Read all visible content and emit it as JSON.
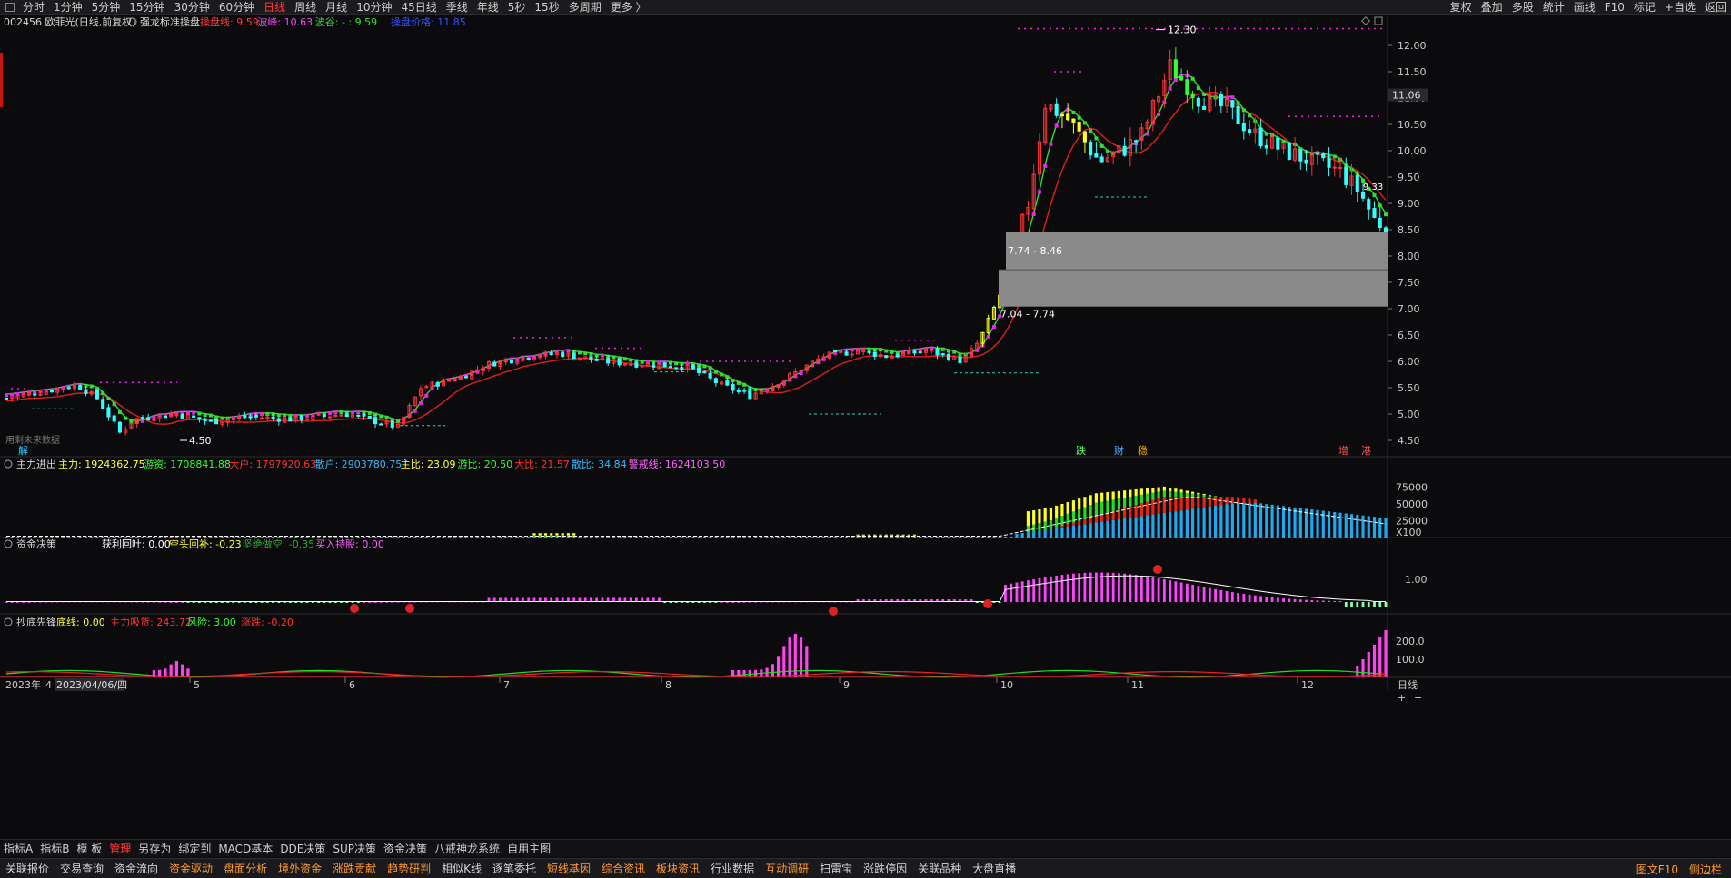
{
  "topbar": {
    "periods": [
      "分时",
      "1分钟",
      "5分钟",
      "15分钟",
      "30分钟",
      "60分钟",
      "日线",
      "周线",
      "月线",
      "10分钟",
      "45日线",
      "季线",
      "年线",
      "5秒",
      "15秒",
      "多周期",
      "更多 〉"
    ],
    "active_period": "日线",
    "right_items": [
      "复权",
      "叠加",
      "多股",
      "统计",
      "画线",
      "F10",
      "标记",
      "+自选",
      "返回"
    ]
  },
  "main_header": {
    "stock": "002456 欧菲光(日线,前复权)",
    "indicator": "强龙标准操盘",
    "items": [
      {
        "label": "操盘线: 9.59",
        "color": "#ff3b3b"
      },
      {
        "label": "波峰: 10.63",
        "color": "#ff44ff"
      },
      {
        "label": "波谷: - : 9.59",
        "color": "#33dd33"
      },
      {
        "label": "操盘价格: 11.85",
        "color": "#3355ff"
      }
    ]
  },
  "price_axis": [
    "12.00",
    "11.50",
    "11.00",
    "10.50",
    "10.00",
    "9.50",
    "9.00",
    "8.50",
    "8.00",
    "7.50",
    "7.00",
    "6.50",
    "6.00",
    "5.50",
    "5.00",
    "4.50"
  ],
  "current_price_tag": "11.06",
  "annotations": {
    "high": "12.30",
    "low": "4.50",
    "right_tag": "9.33",
    "box1": "7.74 - 8.46",
    "box2": "7.04 - 7.74",
    "future": "用剩未来数据",
    "jie": "解",
    "signals": [
      {
        "text": "跌",
        "color": "#66ff66"
      },
      {
        "text": "财",
        "color": "#55aaff"
      },
      {
        "text": "稳",
        "color": "#ffaa00"
      },
      {
        "text": "增",
        "color": "#ff5555"
      },
      {
        "text": "港",
        "color": "#ff5555"
      }
    ]
  },
  "panel1": {
    "title": "主力进出",
    "items": [
      {
        "label": "主力: 1924362.75",
        "color": "#ffff33"
      },
      {
        "label": "游资: 1708841.88",
        "color": "#33ff33"
      },
      {
        "label": "大户: 1797920.63",
        "color": "#ff3333"
      },
      {
        "label": "散户: 2903780.75",
        "color": "#33bbff"
      },
      {
        "label": "主比: 23.09",
        "color": "#ffff33"
      },
      {
        "label": "游比: 20.50",
        "color": "#33ff33"
      },
      {
        "label": "大比: 21.57",
        "color": "#ff3333"
      },
      {
        "label": "散比: 34.84",
        "color": "#33bbff"
      },
      {
        "label": "警戒线: 1624103.50",
        "color": "#ff66ff"
      }
    ],
    "axis": [
      "75000",
      "50000",
      "25000",
      "X100"
    ]
  },
  "panel2": {
    "title": "资金决策",
    "items": [
      {
        "label": "获利回吐: 0.00",
        "color": "#ffffff"
      },
      {
        "label": "空头回补: -0.23",
        "color": "#ffff33"
      },
      {
        "label": "坚绝做空: -0.35",
        "color": "#33aa33"
      },
      {
        "label": "买入持股: 0.00",
        "color": "#ff66ff"
      }
    ],
    "axis": [
      "1.00"
    ]
  },
  "panel3": {
    "title": "抄底先锋",
    "items": [
      {
        "label": "底线: 0.00",
        "color": "#ffff33"
      },
      {
        "label": "主力吸货: 243.72",
        "color": "#ff3333"
      },
      {
        "label": "风险: 3.00",
        "color": "#33ff33"
      },
      {
        "label": "涨跌: -0.20",
        "color": "#ff3333"
      }
    ],
    "axis": [
      "200.0",
      "100.0"
    ]
  },
  "time_axis": {
    "start": "2023年",
    "start2": "4",
    "cursor_date": "2023/04/06/四",
    "months": [
      "5",
      "6",
      "7",
      "8",
      "9",
      "10",
      "11",
      "12"
    ],
    "period": "日线"
  },
  "bottom_tabs": [
    "指标A",
    "指标B",
    "模 板",
    "管理",
    "另存为",
    "绑定到",
    "MACD基本",
    "DDE决策",
    "SUP决策",
    "资金决策",
    "八戒神龙系统",
    "自用主图"
  ],
  "active_tab": "管理",
  "bottom_bar": [
    {
      "text": "关联报价",
      "hl": false
    },
    {
      "text": "交易查询",
      "hl": false
    },
    {
      "text": "资金流向",
      "hl": false
    },
    {
      "text": "资金驱动",
      "hl": true
    },
    {
      "text": "盘面分析",
      "hl": true
    },
    {
      "text": "境外资金",
      "hl": true
    },
    {
      "text": "涨跌贡献",
      "hl": true
    },
    {
      "text": "趋势研判",
      "hl": true
    },
    {
      "text": "相似K线",
      "hl": false
    },
    {
      "text": "逐笔委托",
      "hl": false
    },
    {
      "text": "短线基因",
      "hl": true
    },
    {
      "text": "综合资讯",
      "hl": true
    },
    {
      "text": "板块资讯",
      "hl": true
    },
    {
      "text": "行业数据",
      "hl": false
    },
    {
      "text": "互动调研",
      "hl": true
    },
    {
      "text": "扫雷宝",
      "hl": false
    },
    {
      "text": "涨跌停因",
      "hl": false
    },
    {
      "text": "关联品种",
      "hl": false
    },
    {
      "text": "大盘直播",
      "hl": false
    }
  ],
  "bottom_right": [
    "图文F10",
    "侧边栏"
  ],
  "colors": {
    "up": "#ff3333",
    "down": "#33ffff",
    "ma": "#e01e1e",
    "green_line": "#33dd33",
    "magenta": "#ff22ff",
    "grid": "#1f1f22"
  }
}
